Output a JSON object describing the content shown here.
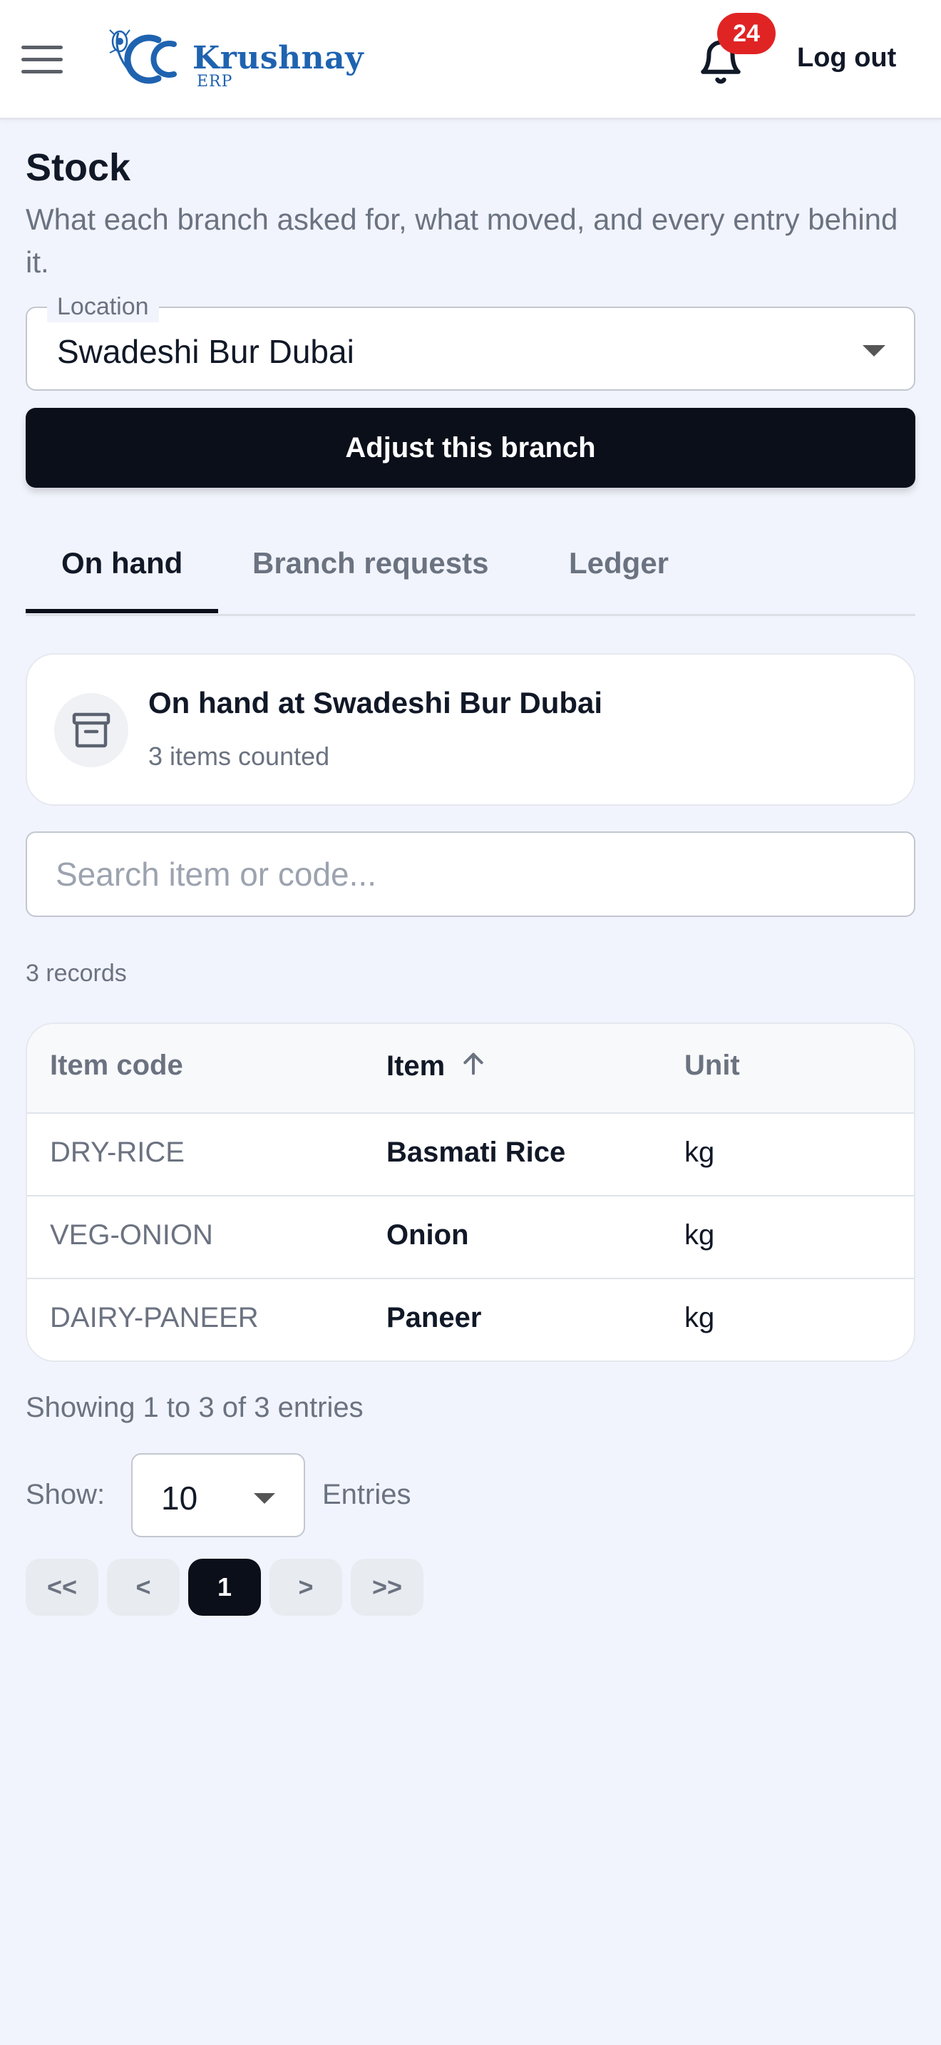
{
  "header": {
    "brand_name": "Krushnay",
    "brand_sub": "ERP",
    "notification_count": "24",
    "logout_label": "Log out"
  },
  "page": {
    "title": "Stock",
    "description": "What each branch asked for, what moved, and every entry behind it."
  },
  "location": {
    "label": "Location",
    "value": "Swadeshi Bur Dubai"
  },
  "adjust_button_label": "Adjust this branch",
  "tabs": [
    {
      "label": "On hand",
      "active": true
    },
    {
      "label": "Branch requests",
      "active": false
    },
    {
      "label": "Ledger",
      "active": false
    }
  ],
  "summary": {
    "title": "On hand at Swadeshi Bur Dubai",
    "subtitle": "3 items counted"
  },
  "search": {
    "placeholder": "Search item or code...",
    "value": ""
  },
  "records_text": "3 records",
  "table": {
    "columns": [
      "Item code",
      "Item",
      "Unit"
    ],
    "sorted_column": "Item",
    "sort_direction": "ascending",
    "rows": [
      {
        "code": "DRY-RICE",
        "item": "Basmati Rice",
        "unit": "kg"
      },
      {
        "code": "VEG-ONION",
        "item": "Onion",
        "unit": "kg"
      },
      {
        "code": "DAIRY-PANEER",
        "item": "Paneer",
        "unit": "kg"
      }
    ]
  },
  "footer": {
    "showing_text": "Showing 1 to 3 of 3 entries",
    "show_label": "Show:",
    "page_size": "10",
    "entries_label": "Entries"
  },
  "pagination": {
    "first": "<<",
    "prev": "<",
    "current": "1",
    "next": ">",
    "last": ">>"
  },
  "colors": {
    "brand": "#1f63b0",
    "primary_button": "#0b0f19",
    "badge": "#e02424",
    "page_background": "#f1f4fc"
  }
}
